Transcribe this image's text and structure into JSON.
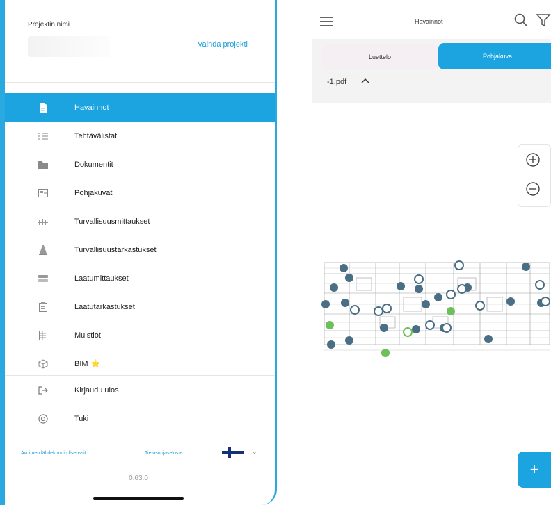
{
  "drawer": {
    "project_label": "Projektin nimi",
    "switch_project": "Vaihda projekti",
    "items": [
      {
        "label": "Havainnot",
        "icon": "document-icon",
        "active": true
      },
      {
        "label": "Tehtävälistat",
        "icon": "checklist-icon",
        "active": false
      },
      {
        "label": "Dokumentit",
        "icon": "folder-icon",
        "active": false
      },
      {
        "label": "Pohjakuvat",
        "icon": "floorplan-icon",
        "active": false
      },
      {
        "label": "Turvallisuusmittaukset",
        "icon": "fence-icon",
        "active": false
      },
      {
        "label": "Turvallisuustarkastukset",
        "icon": "cone-icon",
        "active": false
      },
      {
        "label": "Laatumittaukset",
        "icon": "toggle-icon",
        "active": false
      },
      {
        "label": "Laatutarkastukset",
        "icon": "clipboard-icon",
        "active": false
      },
      {
        "label": "Muistiot",
        "icon": "notes-icon",
        "active": false
      },
      {
        "label": "BIM",
        "icon": "cube-icon",
        "active": false,
        "badge": "⭐"
      }
    ],
    "bottom_items": [
      {
        "label": "Kirjaudu ulos",
        "icon": "logout-icon"
      },
      {
        "label": "Tuki",
        "icon": "lifebuoy-icon"
      }
    ],
    "license_link": "Avoimen lähdekoodin lisenssit",
    "privacy_link": "Tietosuojaseloste",
    "language_flag": "finland-flag-icon",
    "version": "0.63.0"
  },
  "plan_view": {
    "title": "Havainnot",
    "tab_list": "Luettelo",
    "tab_plan": "Pohjakuva",
    "pdf_name": "-1.pdf",
    "fab_label": "+",
    "accent": "#1ba4e0"
  }
}
